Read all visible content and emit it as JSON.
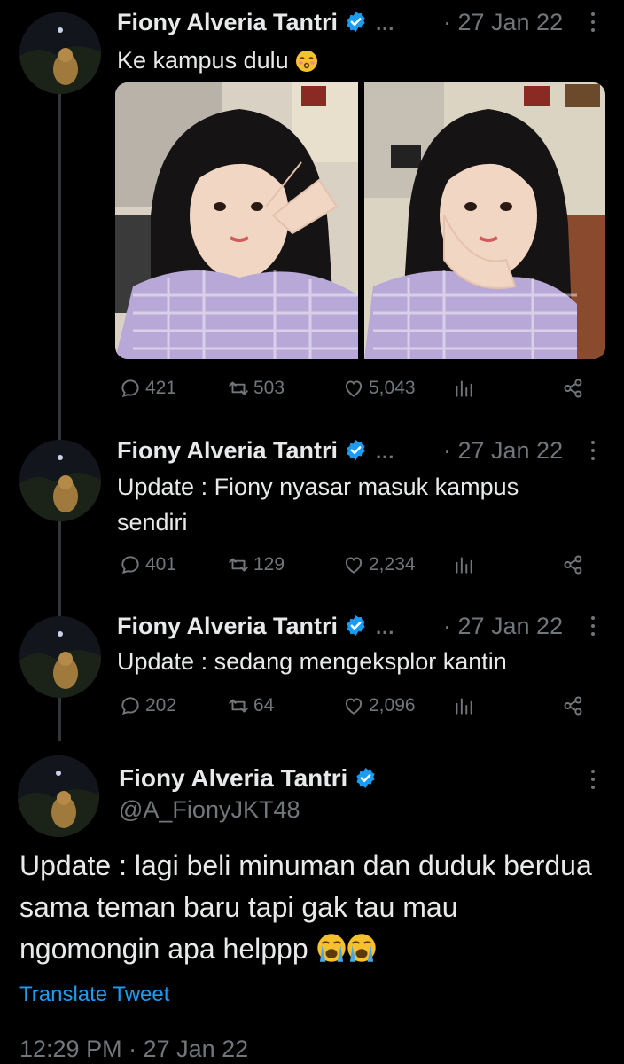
{
  "thread": [
    {
      "name": "Fiony Alveria Tantri",
      "ellipsis": "...",
      "date": "· 27 Jan 22",
      "text": "Ke kampus dulu",
      "text_emoji": "kissing-face-emoji",
      "has_media": true,
      "stats": {
        "replies": "421",
        "retweets": "503",
        "likes": "5,043"
      }
    },
    {
      "name": "Fiony Alveria Tantri",
      "ellipsis": "...",
      "date": "· 27 Jan 22",
      "text": "Update : Fiony nyasar masuk kampus sendiri",
      "stats": {
        "replies": "401",
        "retweets": "129",
        "likes": "2,234"
      }
    },
    {
      "name": "Fiony Alveria Tantri",
      "ellipsis": "...",
      "date": "· 27 Jan 22",
      "text": "Update : sedang mengeksplor kantin",
      "stats": {
        "replies": "202",
        "retweets": "64",
        "likes": "2,096"
      }
    }
  ],
  "main": {
    "name": "Fiony Alveria Tantri",
    "handle": "@A_FionyJKT48",
    "text": "Update : lagi beli minuman dan duduk berdua sama teman baru tapi gak tau mau ngomongin apa helppp",
    "text_emoji": "loudly-crying-face-emoji x2",
    "translate": "Translate Tweet",
    "timestamp": "12:29 PM · 27 Jan 22"
  },
  "colors": {
    "background": "#000000",
    "text": "#e7e9ea",
    "muted": "#71767b",
    "accent": "#1d9bf0",
    "thread_line": "#333639"
  },
  "icons": [
    "reply-icon",
    "retweet-icon",
    "like-icon",
    "analytics-icon",
    "share-icon",
    "verified-badge-icon",
    "more-options-icon"
  ]
}
